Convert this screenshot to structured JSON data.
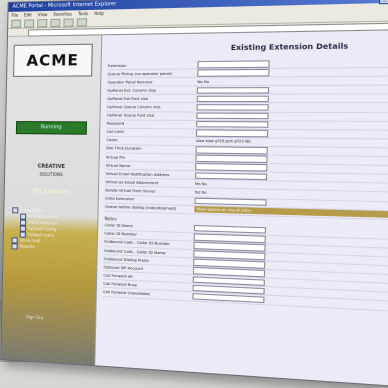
{
  "window": {
    "title": "ACME Portal - Microsoft Internet Explorer",
    "menu": [
      "File",
      "Edit",
      "View",
      "Favorites",
      "Tools",
      "Help"
    ]
  },
  "sidebar": {
    "logo": "ACME",
    "status_button": "Running",
    "brand_line1": "CREATIVE",
    "brand_line2": "SOLUTIONS",
    "section_title": "PBX Extension",
    "tree": [
      {
        "label": "Extensions",
        "level": 0
      },
      {
        "label": "Find Extension",
        "level": 1
      },
      {
        "label": "Add Extension",
        "level": 1
      },
      {
        "label": "Upload Config",
        "level": 1
      },
      {
        "label": "Upload users",
        "level": 1
      },
      {
        "label": "Voice mail",
        "level": 0
      },
      {
        "label": "Reports",
        "level": 0
      }
    ],
    "footer": "Sign Out"
  },
  "main": {
    "title": "Existing Extension Details",
    "rows": [
      {
        "label": "Extension",
        "type": "field",
        "value": ""
      },
      {
        "label": "Queue Pickup (no operator panel)",
        "type": "field",
        "value": ""
      },
      {
        "label": "Operator Panel Remove",
        "type": "radio",
        "value": "Yes  No"
      },
      {
        "label": "OpPanel Ext. Column Size",
        "type": "field",
        "value": ""
      },
      {
        "label": "OpPanel Ext Font size",
        "type": "field",
        "value": ""
      },
      {
        "label": "OpPanel Queue Column size",
        "type": "field",
        "value": ""
      },
      {
        "label": "OpPanel Queue Font size",
        "type": "field",
        "value": ""
      },
      {
        "label": "Password",
        "type": "field",
        "value": ""
      },
      {
        "label": "Call Limit",
        "type": "field",
        "value": ""
      },
      {
        "label": "Codec",
        "type": "radio",
        "value": "ulaw  alaw  g729  gsm  g723  ilbc"
      },
      {
        "label": "Dial Time Duration",
        "type": "field",
        "value": ""
      },
      {
        "label": "Virtual Pin",
        "type": "field",
        "value": ""
      },
      {
        "label": "Virtual Name",
        "type": "field",
        "value": ""
      },
      {
        "label": "Virtual Email Notification Address",
        "type": "field",
        "value": ""
      },
      {
        "label": "Virtual as Email Attachment",
        "type": "radio",
        "value": "Yes  No"
      },
      {
        "label": "Delete Virtual From Server",
        "type": "radio",
        "value": "Yes  No"
      },
      {
        "label": "Child Extension",
        "type": "field",
        "value": ""
      },
      {
        "label": "Queue before dialing (hide/observed)",
        "type": "highlight",
        "value": "Show options on ring all entry"
      }
    ],
    "section2": "Notes",
    "rows2": [
      {
        "label": "Caller ID Name",
        "type": "field",
        "value": ""
      },
      {
        "label": "Caller ID Number",
        "type": "field",
        "value": ""
      },
      {
        "label": "Outbound Calls - Caller ID Number",
        "type": "field",
        "value": ""
      },
      {
        "label": "Outbound Calls - Caller ID Name",
        "type": "field",
        "value": ""
      },
      {
        "label": "Outbound Dialing Prefix",
        "type": "field",
        "value": ""
      },
      {
        "label": "Optional SIP Account",
        "type": "field",
        "value": ""
      },
      {
        "label": "Call Forward All",
        "type": "field",
        "value": ""
      },
      {
        "label": "Call Forward Busy",
        "type": "field",
        "value": ""
      },
      {
        "label": "Call Forward Unavailable",
        "type": "field",
        "value": ""
      }
    ]
  }
}
